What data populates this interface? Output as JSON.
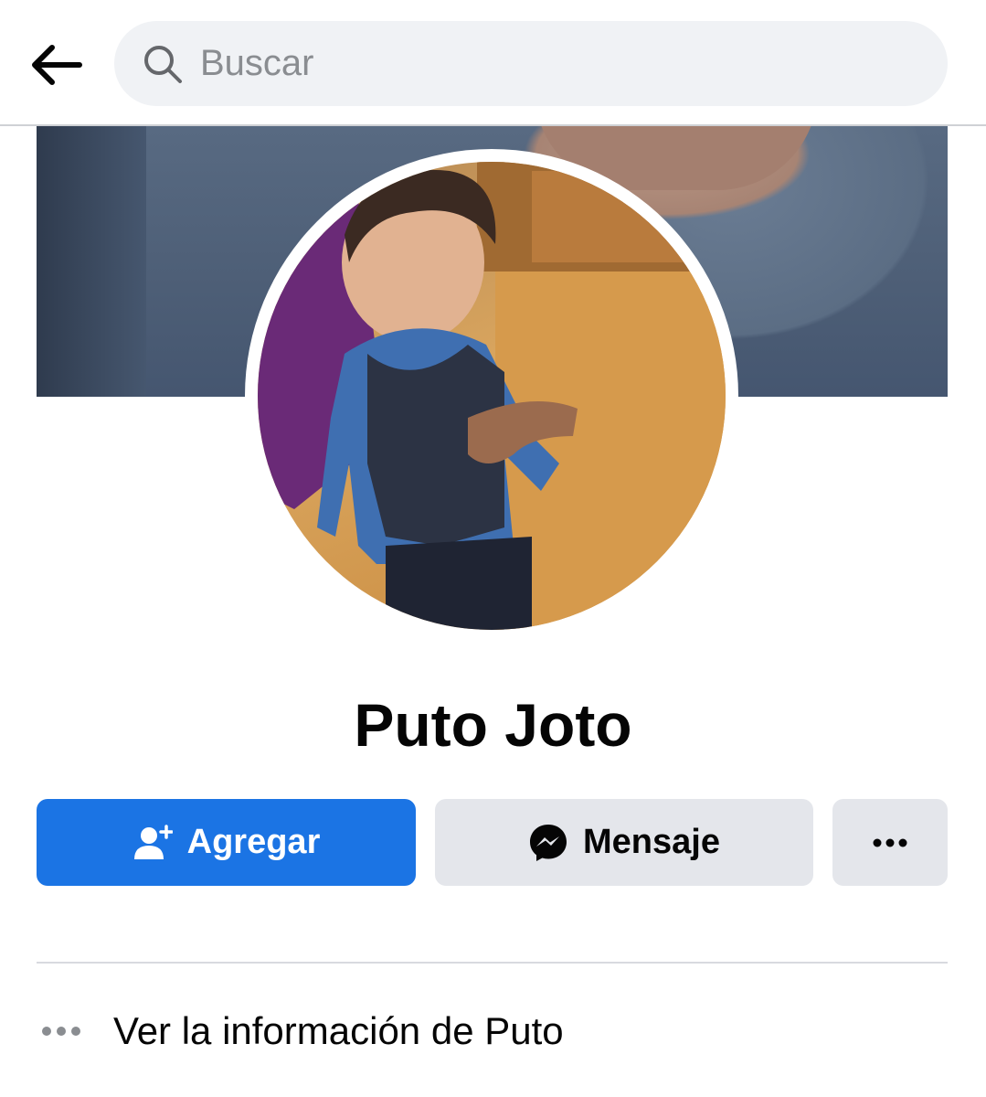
{
  "search": {
    "placeholder": "Buscar"
  },
  "profile": {
    "name": "Puto Joto"
  },
  "actions": {
    "add_label": "Agregar",
    "message_label": "Mensaje"
  },
  "info": {
    "label": "Ver la información de Puto"
  },
  "icons": {
    "back": "arrow-left-icon",
    "search": "search-icon",
    "add_friend": "add-friend-icon",
    "messenger": "messenger-icon",
    "more": "more-dots-icon",
    "info_more": "more-dots-icon"
  },
  "colors": {
    "primary_button": "#1b74e4",
    "secondary_button": "#e4e6eb",
    "search_bg": "#f0f2f5"
  }
}
